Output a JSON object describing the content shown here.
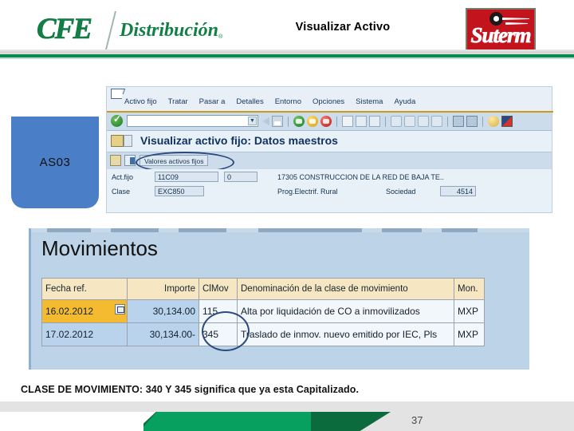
{
  "header": {
    "logo_mark": "CFE",
    "logo_word": "Distribución",
    "logo_reg": "®",
    "title": "Visualizar Activo",
    "partner_logo": "Suterm"
  },
  "callout": {
    "tcode": "AS03"
  },
  "sap": {
    "menu": [
      "Activo fijo",
      "Tratar",
      "Pasar a",
      "Detalles",
      "Entorno",
      "Opciones",
      "Sistema",
      "Ayuda"
    ],
    "command_field_value": "",
    "command_field_placeholder": "",
    "screen_title": "Visualizar activo fijo:  Datos maestros",
    "app_button": "Valores activos fijos",
    "fields": {
      "asset_label": "Act.fijo",
      "asset_value": "11C09",
      "asset_subnumber": "0",
      "class_label": "Clase",
      "class_value": "EXC850",
      "description": "17305 CONSTRUCCION DE LA RED DE BAJA TE..",
      "program": "Prog.Electrif. Rural",
      "company_label": "Sociedad",
      "company_value": "4514"
    }
  },
  "movimientos": {
    "title": "Movimientos",
    "columns": [
      "Fecha ref.",
      "Importe",
      "ClMov",
      "Denominación de la clase de movimiento",
      "Mon."
    ],
    "rows": [
      {
        "fecha": "16.02.2012",
        "importe": "30,134.00",
        "clmov": "115",
        "denominacion": "Alta por liquidación de CO a inmovilizados",
        "moneda": "MXP"
      },
      {
        "fecha": "17.02.2012",
        "importe": "30,134.00-",
        "clmov": "345",
        "denominacion": "Traslado de inmov. nuevo emitido por IEC, Pls",
        "moneda": "MXP"
      }
    ]
  },
  "caption": "CLASE DE MOVIMIENTO: 340 Y 345 significa que ya esta Capitalizado.",
  "footer": {
    "page_number": "37"
  },
  "colors": {
    "cfe_green": "#128046",
    "callout_blue": "#4a7fc8",
    "highlight_amber": "#f4bb31",
    "annotation_circle": "#2a4a80",
    "suterm_red": "#c3141d"
  }
}
